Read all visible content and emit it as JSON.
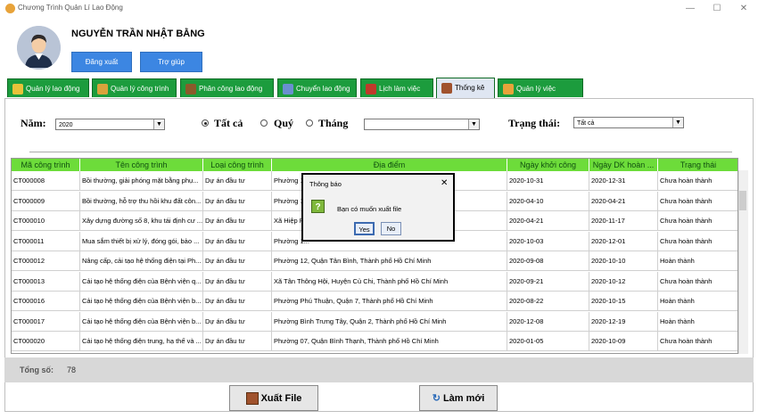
{
  "window": {
    "title": "Chương Trình Quản Lí Lao Động",
    "min_glyph": "—",
    "max_glyph": "☐",
    "close_glyph": "✕"
  },
  "header": {
    "user_name": "NGUYỄN TRẦN NHẬT BẰNG",
    "logout_label": "Đăng xuất",
    "help_label": "Trợ giúp"
  },
  "tabs": [
    {
      "label": "Quản lý lao động",
      "color": "#e8c23a"
    },
    {
      "label": "Quản lý công trình",
      "color": "#d9a33c"
    },
    {
      "label": "Phân công lao động",
      "color": "#8b5a2b"
    },
    {
      "label": "Chuyển lao động",
      "color": "#6a8fd0"
    },
    {
      "label": "Lịch làm việc",
      "color": "#c0392b"
    },
    {
      "label": "Thống kê",
      "color": "#a0522d"
    },
    {
      "label": "Quản lý việc",
      "color": "#e8a33a"
    }
  ],
  "filters": {
    "year_label": "Năm:",
    "year_value": "2020",
    "radio_all": "Tất cả",
    "radio_quarter": "Quý",
    "radio_month": "Tháng",
    "month_value": "",
    "status_label": "Trạng thái:",
    "status_value": "Tất cả",
    "dropdown_arrow": "▼"
  },
  "table": {
    "headers": [
      "Mã công trình",
      "Tên công trình",
      "Loại công trình",
      "Địa điểm",
      "Ngày khởi công",
      "Ngày DK hoàn ...",
      "Trạng thái"
    ],
    "rows": [
      [
        "CT000008",
        "Bồi thường, giải phóng mặt bằng phụ...",
        "Dự án đầu tư",
        "Phường 1...",
        "2020-10-31",
        "2020-12-31",
        "Chưa hoàn thành"
      ],
      [
        "CT000009",
        "Bồi thường, hỗ trợ thu hồi khu đất côn...",
        "Dự án đầu tư",
        "Phường 1...",
        "2020-04-10",
        "2020-04-21",
        "Chưa hoàn thành"
      ],
      [
        "CT000010",
        "Xây dựng đường số 8, khu tái định cư ...",
        "Dự án đầu tư",
        "Xã Hiệp P...",
        "2020-04-21",
        "2020-11-17",
        "Chưa hoàn thành"
      ],
      [
        "CT000011",
        "Mua sắm thiết bị xử lý, đóng gói, bảo ...",
        "Dự án đầu tư",
        "Phường 1...",
        "2020-10-03",
        "2020-12-01",
        "Chưa hoàn thành"
      ],
      [
        "CT000012",
        "Nâng cấp, cải tạo hệ thống điện tại Ph...",
        "Dự án đầu tư",
        "Phường 12, Quận Tân Bình, Thành phố Hồ Chí Minh",
        "2020-09-08",
        "2020-10-10",
        "Hoàn thành"
      ],
      [
        "CT000013",
        "Cải tạo hệ thống điện của Bệnh viện q...",
        "Dự án đầu tư",
        "Xã Tân Thông Hội, Huyện Củ Chi, Thành phố Hồ Chí Minh",
        "2020-09-21",
        "2020-10-12",
        "Chưa hoàn thành"
      ],
      [
        "CT000016",
        "Cải tạo hệ thống điện của Bệnh viện b...",
        "Dự án đầu tư",
        "Phường Phú Thuận, Quận 7, Thành phố Hồ Chí Minh",
        "2020-08-22",
        "2020-10-15",
        "Hoàn thành"
      ],
      [
        "CT000017",
        "Cải tạo hệ thống điện của Bệnh viện b...",
        "Dự án đầu tư",
        "Phường Bình Trưng Tây, Quận 2, Thành phố Hồ Chí Minh",
        "2020-12-08",
        "2020-12-19",
        "Hoàn thành"
      ],
      [
        "CT000020",
        "Cải tạo hệ thống điện trung, hạ thế và ...",
        "Dự án đầu tư",
        "Phường 07, Quận Bình Thạnh, Thành phố Hồ Chí Minh",
        "2020-01-05",
        "2020-10-09",
        "Chưa hoàn thành"
      ]
    ]
  },
  "footer": {
    "total_label": "Tổng số:",
    "total_value": "78",
    "export_label": "Xuất File",
    "refresh_label": "Làm mới"
  },
  "dialog": {
    "title": "Thông báo",
    "message": "Bạn có muốn xuất file",
    "yes_label": "Yes",
    "no_label": "No",
    "icon_glyph": "?",
    "close_glyph": "✕"
  }
}
